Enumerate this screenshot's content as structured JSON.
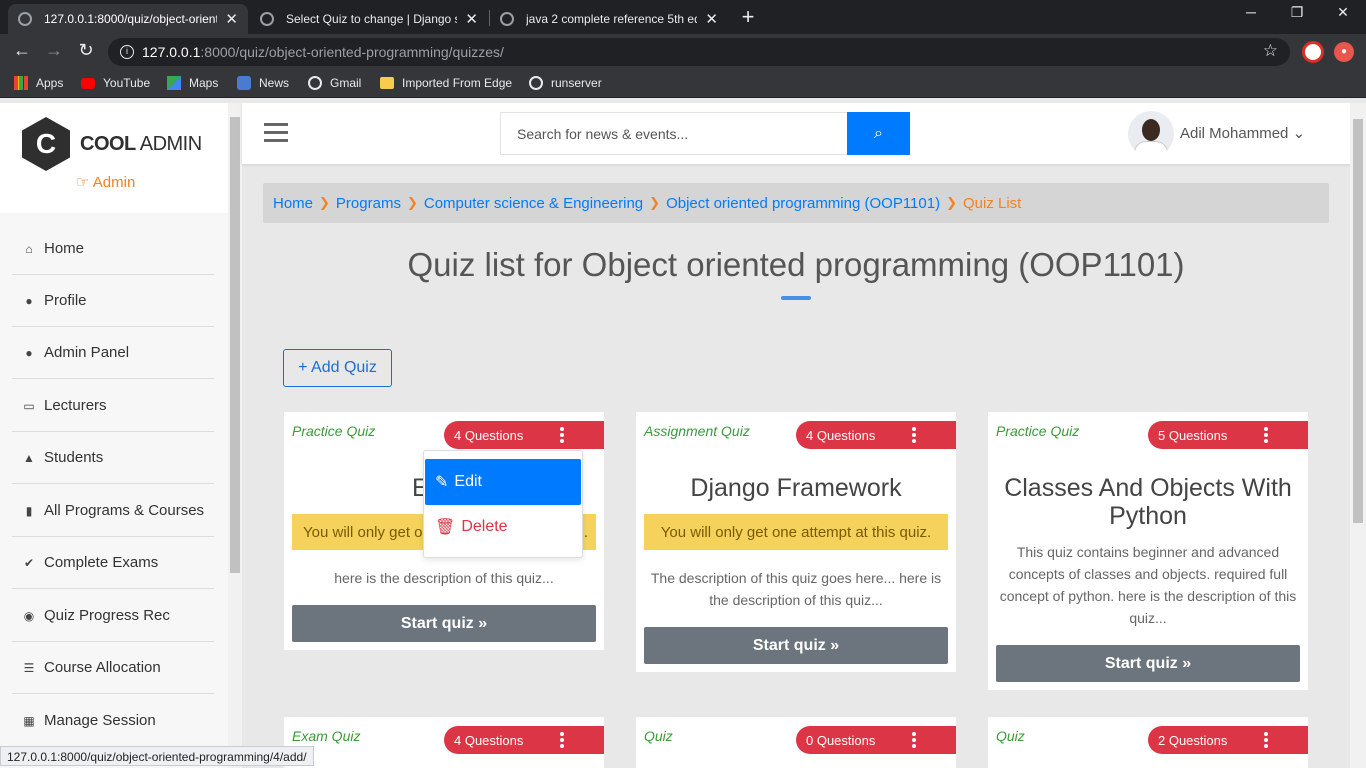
{
  "browser": {
    "tabs": [
      {
        "title": "127.0.0.1:8000/quiz/object-orient",
        "active": true
      },
      {
        "title": "Select Quiz to change | Django si",
        "active": false
      },
      {
        "title": "java 2 complete reference 5th edi",
        "active": false
      }
    ],
    "new_tab": "+",
    "url_host": "127.0.0.1",
    "url_path": ":8000/quiz/object-oriented-programming/quizzes/",
    "bookmarks": [
      "Apps",
      "YouTube",
      "Maps",
      "News",
      "Gmail",
      "Imported From Edge",
      "runserver"
    ],
    "status_url": "127.0.0.1:8000/quiz/object-oriented-programming/4/add/"
  },
  "sidebar": {
    "logo_letter": "C",
    "brand_bold": "COOL",
    "brand_rest": " ADMIN",
    "role": "Admin",
    "items": [
      {
        "label": "Home",
        "icon": "home-icon"
      },
      {
        "label": "Profile",
        "icon": "user-icon"
      },
      {
        "label": "Admin Panel",
        "icon": "user-tie-icon"
      },
      {
        "label": "Lecturers",
        "icon": "chalkboard-icon"
      },
      {
        "label": "Students",
        "icon": "graduate-icon"
      },
      {
        "label": "All Programs & Courses",
        "icon": "book-icon"
      },
      {
        "label": "Complete Exams",
        "icon": "check-icon"
      },
      {
        "label": "Quiz Progress Rec",
        "icon": "record-icon"
      },
      {
        "label": "Course Allocation",
        "icon": "list-icon"
      },
      {
        "label": "Manage Session",
        "icon": "calendar-icon"
      }
    ]
  },
  "header": {
    "search_placeholder": "Search for news & events...",
    "user_name": "Adil Mohammed"
  },
  "breadcrumb": {
    "items": [
      "Home",
      "Programs",
      "Computer science & Engineering",
      "Object oriented programming (OOP1101)"
    ],
    "current": "Quiz List"
  },
  "main": {
    "title": "Quiz list for Object oriented programming (OOP1101)",
    "add_button": "+ Add Quiz",
    "start_label": "Start quiz »",
    "warning": "You will only get one attempt at this quiz."
  },
  "quizzes": [
    {
      "category": "Practice Quiz",
      "questions": "4 Questions",
      "title": "Exam",
      "warning_visible": "You will only get o",
      "warning_tail": ".",
      "desc": "here is the description of this quiz..."
    },
    {
      "category": "Assignment Quiz",
      "questions": "4 Questions",
      "title": "Django Framework",
      "desc": "The description of this quiz goes here... here is the description of this quiz..."
    },
    {
      "category": "Practice Quiz",
      "questions": "5 Questions",
      "title": "Classes And Objects With Python",
      "desc": "This quiz contains beginner and advanced concepts of classes and objects. required full concept of python. here is the description of this quiz..."
    },
    {
      "category": "Exam Quiz",
      "questions": "4 Questions"
    },
    {
      "category": "Quiz",
      "questions": "0 Questions"
    },
    {
      "category": "Quiz",
      "questions": "2 Questions"
    }
  ],
  "dropdown": {
    "edit": "Edit",
    "delete": "Delete"
  },
  "colors": {
    "primary": "#007bff",
    "danger": "#dc3545",
    "accent": "#f58220",
    "warning": "#f5d25c",
    "success_text": "#3a9a3a"
  }
}
